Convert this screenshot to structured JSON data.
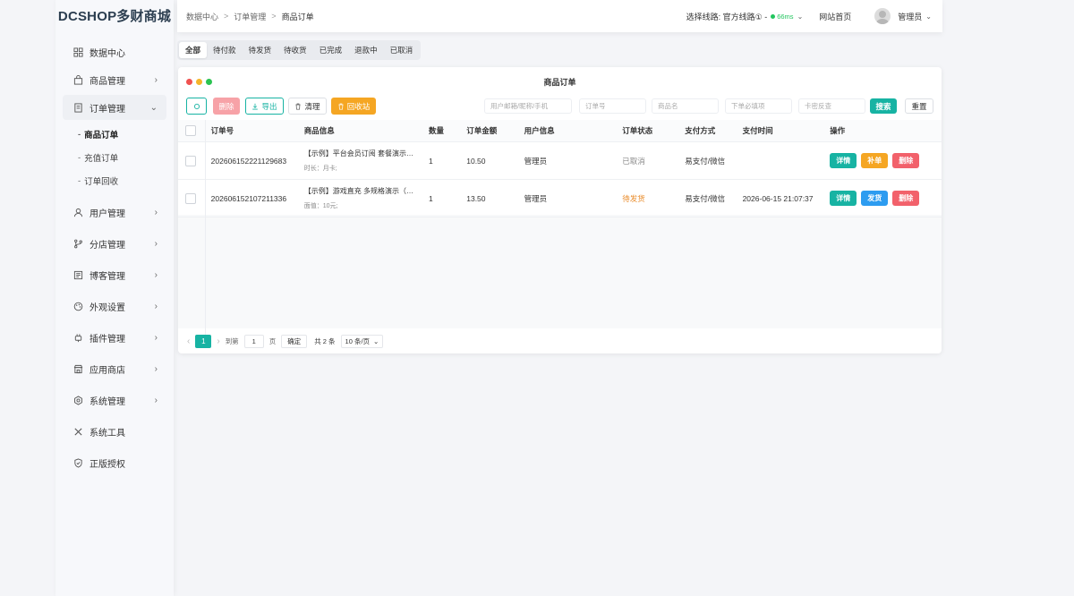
{
  "app": {
    "logo": "DCSHOP多财商城"
  },
  "sidebar": {
    "items": [
      {
        "label": "数据中心",
        "icon": "dashboard-icon"
      },
      {
        "label": "商品管理",
        "icon": "bag-icon"
      },
      {
        "label": "订单管理",
        "icon": "order-icon"
      },
      {
        "label": "用户管理",
        "icon": "user-icon"
      },
      {
        "label": "分店管理",
        "icon": "branch-icon"
      },
      {
        "label": "博客管理",
        "icon": "blog-icon"
      },
      {
        "label": "外观设置",
        "icon": "palette-icon"
      },
      {
        "label": "插件管理",
        "icon": "plugin-icon"
      },
      {
        "label": "应用商店",
        "icon": "store-icon"
      },
      {
        "label": "系统管理",
        "icon": "settings-icon"
      },
      {
        "label": "系统工具",
        "icon": "tools-icon"
      },
      {
        "label": "正版授权",
        "icon": "shield-icon"
      }
    ],
    "sub_items": [
      {
        "dash": "-",
        "label": "商品订单"
      },
      {
        "dash": "-",
        "label": "充值订单"
      },
      {
        "dash": "-",
        "label": "订单回收"
      }
    ]
  },
  "header": {
    "breadcrumb": [
      "数据中心",
      "订单管理",
      "商品订单"
    ],
    "sep": ">",
    "line_label": "选择线路: 官方线路① -",
    "latency": "66ms",
    "home": "网站首页",
    "user": "管理员"
  },
  "tabs": [
    "全部",
    "待付款",
    "待发货",
    "待收货",
    "已完成",
    "退款中",
    "已取消"
  ],
  "panel": {
    "title": "商品订单"
  },
  "toolbar": {
    "delete": "删除",
    "export": "导出",
    "clear": "清理",
    "recycle": "回收站",
    "search": "搜索",
    "reset": "重置",
    "placeholders": {
      "user": "用户邮箱/昵称/手机",
      "order_no": "订单号",
      "product": "商品名",
      "required": "下单必填项",
      "card": "卡密反查"
    }
  },
  "table": {
    "headers": [
      "订单号",
      "商品信息",
      "数量",
      "订单金额",
      "用户信息",
      "订单状态",
      "支付方式",
      "支付时间",
      "操作"
    ],
    "rows": [
      {
        "order_no": "202606152221129683",
        "product": "【示例】平台会员订阅 套餐演示…",
        "product_sub": "时长：月卡;",
        "qty": "1",
        "amount": "10.50",
        "user": "管理员",
        "status": "已取消",
        "pay_method": "易支付/微信",
        "pay_time": "",
        "actions": [
          "详情",
          "补单",
          "删除"
        ]
      },
      {
        "order_no": "202606152107211336",
        "product": "【示例】游戏直充 多规格演示（…",
        "product_sub": "面值：10元;",
        "qty": "1",
        "amount": "13.50",
        "user": "管理员",
        "status": "待发货",
        "pay_method": "易支付/微信",
        "pay_time": "2026-06-15 21:07:37",
        "actions": [
          "详情",
          "发货",
          "删除"
        ]
      }
    ]
  },
  "pagination": {
    "current": "1",
    "goto_prefix": "到第",
    "goto_value": "1",
    "goto_suffix": "页",
    "confirm": "确定",
    "total": "共 2 条",
    "page_size": "10 条/页"
  },
  "colors": {
    "teal": "#17b3a3",
    "orange": "#f5a623",
    "red": "#f2616b",
    "blue": "#2d9cf0",
    "status_pending": "#e98b2a",
    "status_cancelled": "#888888"
  }
}
